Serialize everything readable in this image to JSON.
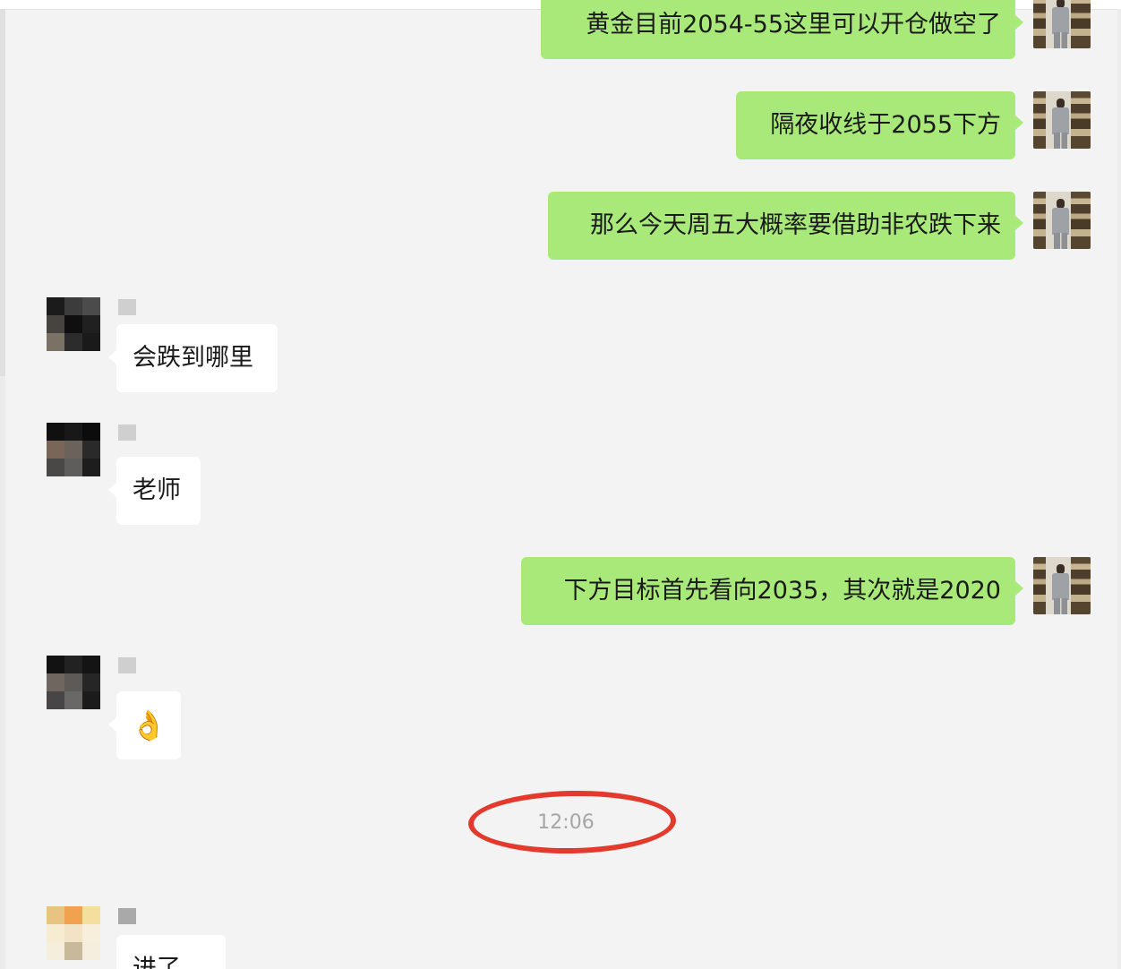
{
  "messages": [
    {
      "side": "right",
      "text": "黄金目前2054-55这里可以开仓做空了"
    },
    {
      "side": "right",
      "text": "隔夜收线于2055下方"
    },
    {
      "side": "right",
      "text": "那么今天周五大概率要借助非农跌下来"
    },
    {
      "side": "left",
      "text": "会跌到哪里"
    },
    {
      "side": "left",
      "text": "老师"
    },
    {
      "side": "right",
      "text": "下方目标首先看向2035，其次就是2020"
    },
    {
      "side": "left",
      "text": "👌"
    },
    {
      "side": "left",
      "text": "进了"
    }
  ],
  "timestamp": "12:06",
  "colors": {
    "outgoing_bubble": "#a9e979",
    "incoming_bubble": "#ffffff",
    "background": "#f3f3f3",
    "highlight_ring": "#e23b2e"
  }
}
